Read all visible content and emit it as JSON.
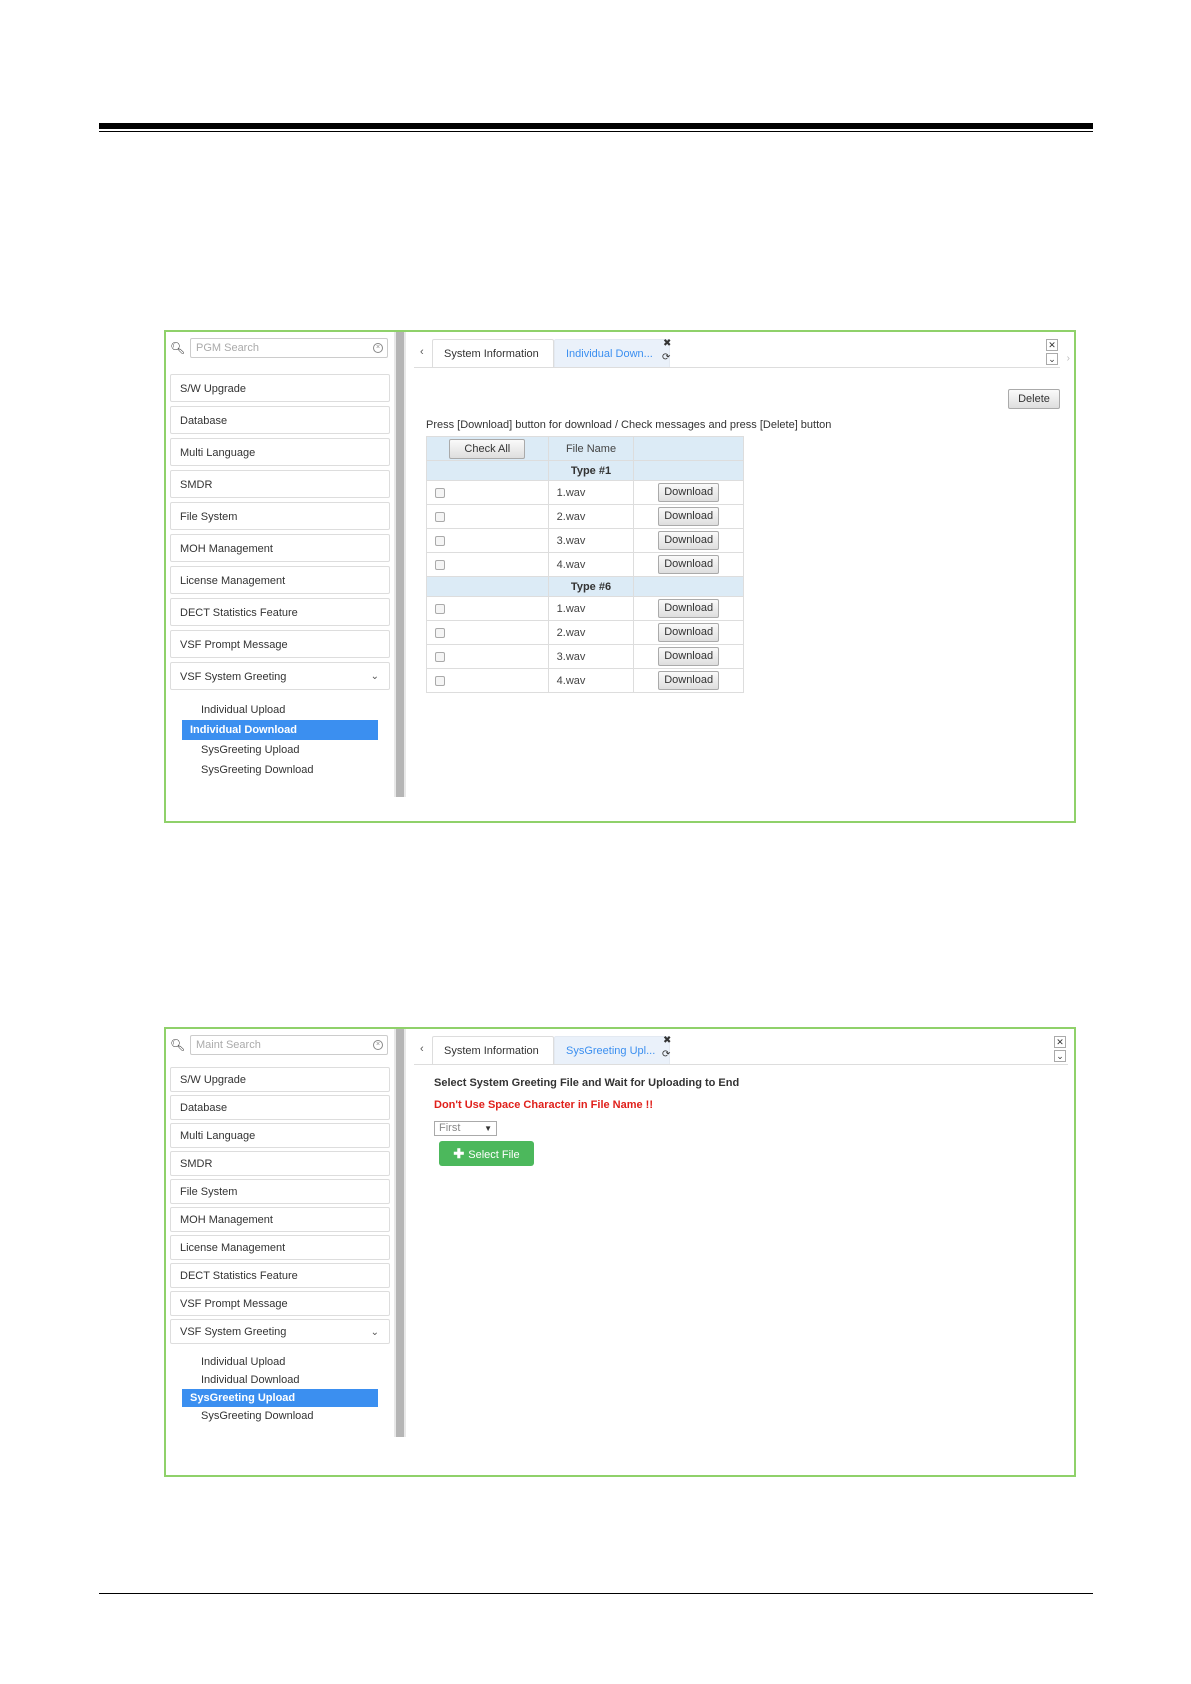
{
  "screenshot1": {
    "search": {
      "placeholder": "PGM Search"
    },
    "menu": [
      "S/W Upgrade",
      "Database",
      "Multi Language",
      "SMDR",
      "File System",
      "MOH Management",
      "License Management",
      "DECT Statistics Feature",
      "VSF Prompt Message",
      "VSF System Greeting"
    ],
    "submenu": [
      "Individual Upload",
      "Individual Download",
      "SysGreeting Upload",
      "SysGreeting Download"
    ],
    "submenu_active": "Individual Download",
    "tabs": {
      "prev": "‹",
      "tab1": "System Information",
      "tab2": "Individual Down..."
    },
    "delete_label": "Delete",
    "instruction": "Press [Download] button for download / Check messages and press [Delete] button",
    "table": {
      "check_all": "Check All",
      "file_name_header": "File Name",
      "groups": [
        {
          "type": "Type #1",
          "files": [
            "1.wav",
            "2.wav",
            "3.wav",
            "4.wav"
          ]
        },
        {
          "type": "Type #6",
          "files": [
            "1.wav",
            "2.wav",
            "3.wav",
            "4.wav"
          ]
        }
      ],
      "download_label": "Download"
    }
  },
  "screenshot2": {
    "search": {
      "placeholder": "Maint Search"
    },
    "menu": [
      "S/W Upgrade",
      "Database",
      "Multi Language",
      "SMDR",
      "File System",
      "MOH Management",
      "License Management",
      "DECT Statistics Feature",
      "VSF Prompt Message",
      "VSF System Greeting"
    ],
    "submenu": [
      "Individual Upload",
      "Individual Download",
      "SysGreeting Upload",
      "SysGreeting Download"
    ],
    "submenu_active": "SysGreeting Upload",
    "tabs": {
      "prev": "‹",
      "tab1": "System Information",
      "tab2": "SysGreeting Upl..."
    },
    "line1": "Select System Greeting File and Wait for Uploading to End",
    "line2": "Don't Use Space Character in File Name !!",
    "select_value": "First",
    "select_file_label": "Select File"
  },
  "colors": {
    "accent": "#3b8ff0",
    "frame": "#8fd16a",
    "warning": "#e0201b",
    "select_file": "#4cb85c",
    "table_header": "#dcebf6"
  }
}
